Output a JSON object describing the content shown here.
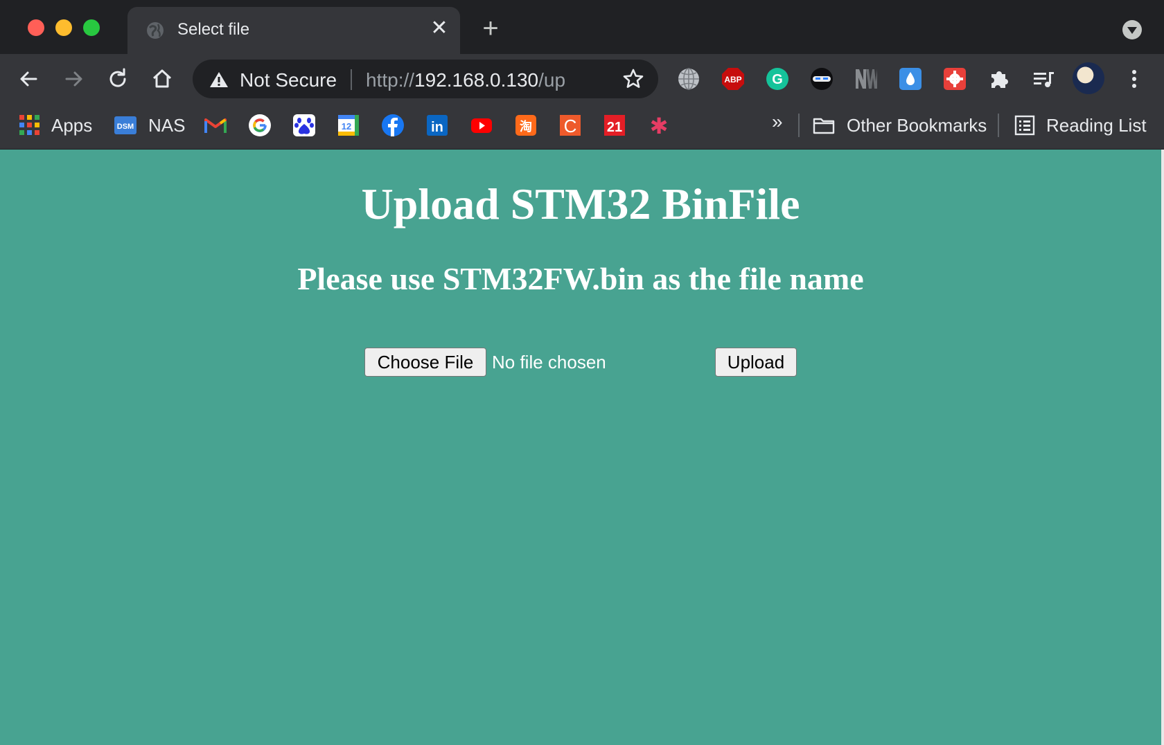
{
  "tab": {
    "title": "Select file",
    "close_glyph": "✕"
  },
  "newtab_glyph": "+",
  "omnibox": {
    "security_label": "Not Secure",
    "url_scheme": "http://",
    "url_host": "192.168.0.130",
    "url_path": "/up"
  },
  "extensions": [
    "globe-icon",
    "adblock-plus-icon",
    "grammarly-icon",
    "ninja-icon",
    "nw-icon",
    "droplet-icon",
    "settings-gear-icon",
    "puzzle-extensions-icon",
    "media-queue-icon"
  ],
  "extension_texts": {
    "abp": "ABP",
    "grammarly": "G"
  },
  "bookmarks": {
    "apps": "Apps",
    "nas_badge": "DSM",
    "nas": "NAS",
    "calendar_day": "12",
    "linkedin": "in",
    "taobao": "淘",
    "c_icon": "C",
    "twentyone": "21",
    "asterisk": "✱",
    "more": "»",
    "other": "Other Bookmarks",
    "reading": "Reading List"
  },
  "page": {
    "heading": "Upload STM32 BinFile",
    "subheading": "Please use STM32FW.bin as the file name",
    "choose_file": "Choose File",
    "file_status": "No file chosen",
    "upload": "Upload",
    "background": "#48a391"
  }
}
